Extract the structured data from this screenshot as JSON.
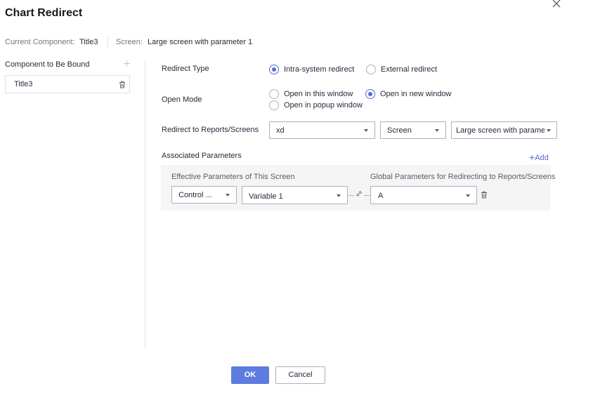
{
  "dialog": {
    "title": "Chart Redirect",
    "ok_label": "OK",
    "cancel_label": "Cancel"
  },
  "info": {
    "component_label": "Current Component:",
    "component_value": "Title3",
    "screen_label": "Screen:",
    "screen_value": "Large screen with parameter 1"
  },
  "left_panel": {
    "header": "Component to Be Bound",
    "items": [
      {
        "label": "Title3"
      }
    ]
  },
  "form": {
    "redirect_type": {
      "label": "Redirect Type",
      "options": [
        {
          "label": "Intra-system redirect",
          "selected": true
        },
        {
          "label": "External redirect",
          "selected": false
        }
      ]
    },
    "open_mode": {
      "label": "Open Mode",
      "options": [
        {
          "label": "Open in this window",
          "selected": false
        },
        {
          "label": "Open in new window",
          "selected": true
        },
        {
          "label": "Open in popup window",
          "selected": false
        }
      ]
    },
    "redirect_to": {
      "label": "Redirect to Reports/Screens",
      "selects": [
        {
          "value": "xd"
        },
        {
          "value": "Screen"
        },
        {
          "value": "Large screen with paramete"
        }
      ]
    },
    "associated": {
      "label": "Associated Parameters",
      "add_label": "Add",
      "effective_header": "Effective Parameters of This Screen",
      "global_header": "Global Parameters for Redirecting to Reports/Screens",
      "rows": [
        {
          "source": "Control ...",
          "variable": "Variable 1",
          "target": "A"
        }
      ]
    }
  },
  "colors": {
    "accent": "#526ecc",
    "primary_button": "#5e7ce0",
    "panel_bg": "#f5f5f6",
    "border": "#adb0b8"
  }
}
